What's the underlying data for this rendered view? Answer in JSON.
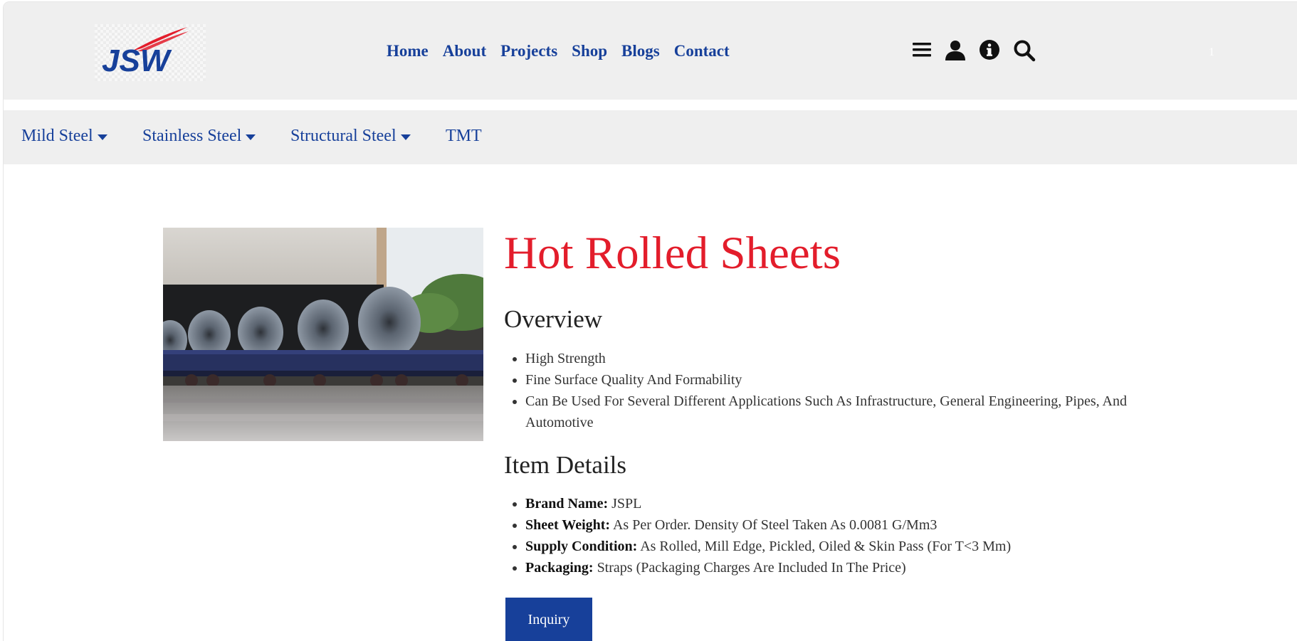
{
  "header": {
    "logo_text": "JSW",
    "nav": [
      "Home",
      "About",
      "Projects",
      "Shop",
      "Blogs",
      "Contact"
    ],
    "icons": [
      "menu-icon",
      "user-icon",
      "info-icon",
      "search-icon"
    ],
    "cart_count": "1"
  },
  "subnav": {
    "items": [
      {
        "label": "Mild Steel",
        "dropdown": true
      },
      {
        "label": "Stainless Steel",
        "dropdown": true
      },
      {
        "label": "Structural Steel",
        "dropdown": true
      },
      {
        "label": "TMT",
        "dropdown": false
      }
    ]
  },
  "product": {
    "title": "Hot Rolled Sheets",
    "overview_heading": "Overview",
    "overview": [
      "High Strength",
      "Fine Surface Quality And Formability",
      "Can Be Used For Several Different Applications Such As Infrastructure, General Engineering, Pipes, And Automotive"
    ],
    "details_heading": "Item Details",
    "details": [
      {
        "label": "Brand Name:",
        "value": "JSPL"
      },
      {
        "label": "Sheet Weight:",
        "value": "As Per Order. Density Of Steel Taken As 0.0081 G/Mm3"
      },
      {
        "label": "Supply Condition:",
        "value": "As Rolled, Mill Edge, Pickled, Oiled & Skin Pass (For T<3 Mm)"
      },
      {
        "label": "Packaging:",
        "value": "Straps (Packaging Charges Are Included In The Price)"
      }
    ],
    "inquiry_label": "Inquiry"
  },
  "colors": {
    "brand_blue": "#17409a",
    "title_red": "#e31d2b",
    "header_bg": "#efefef"
  }
}
